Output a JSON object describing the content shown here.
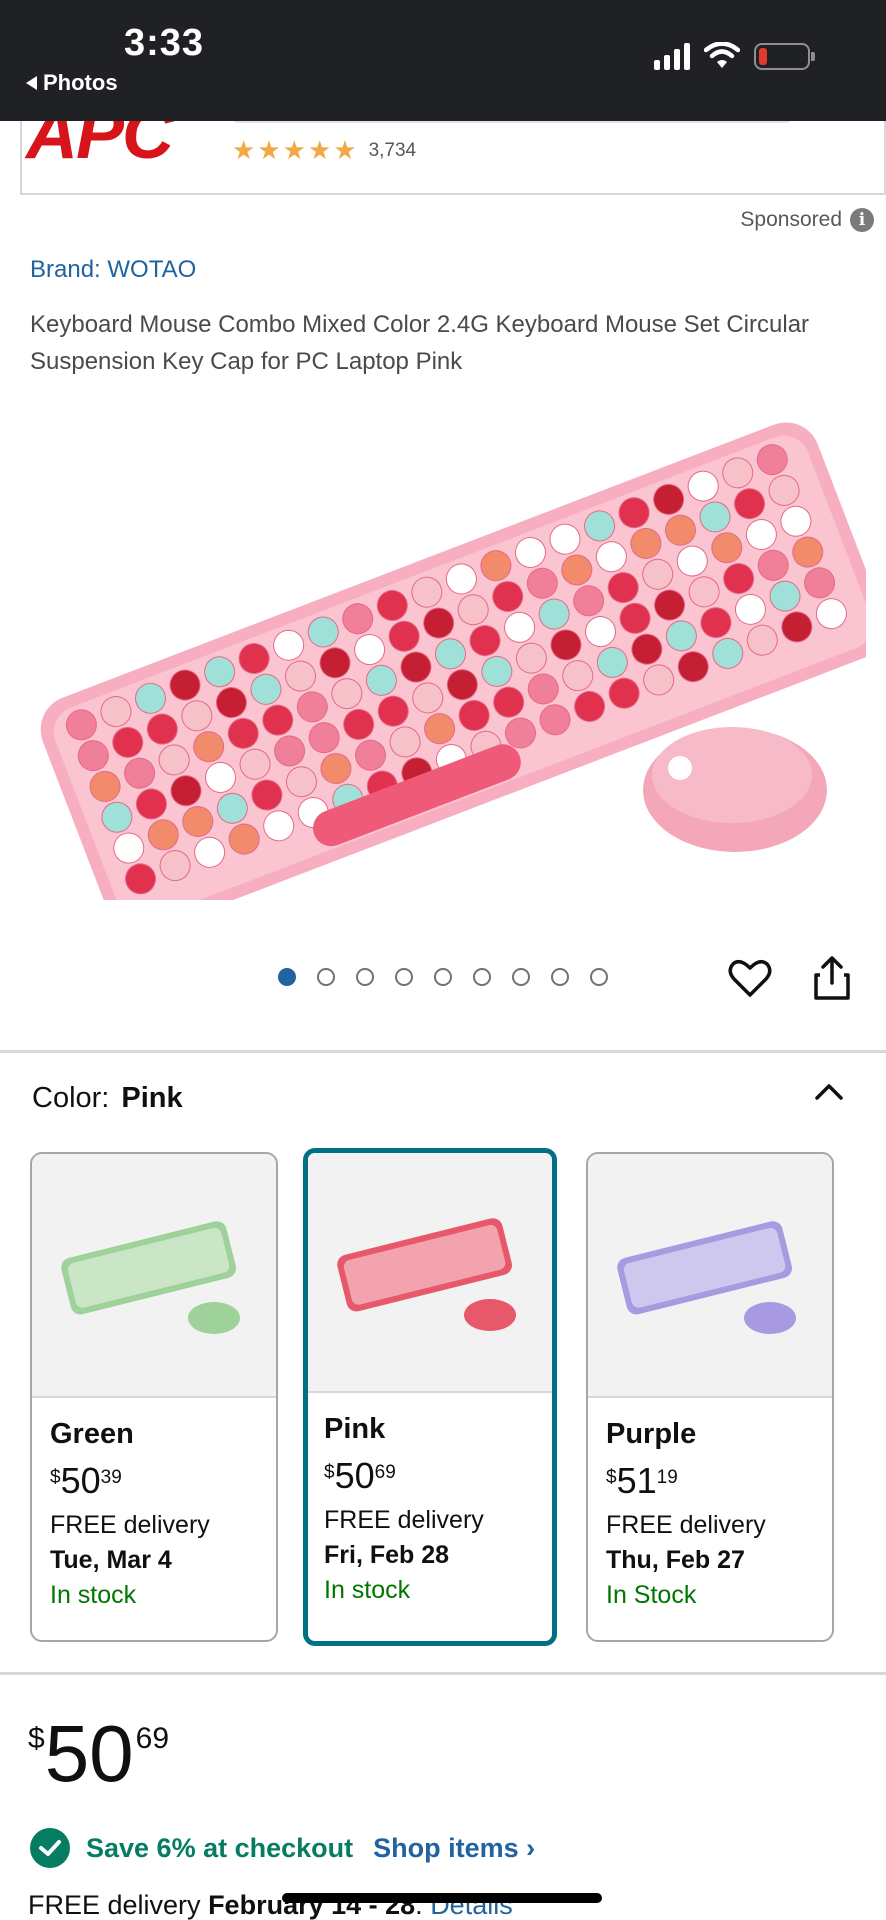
{
  "status_bar": {
    "time": "3:33",
    "back_label": "Photos",
    "icons": [
      "signal-icon",
      "wifi-icon",
      "battery-low-icon"
    ]
  },
  "ad_banner": {
    "logo_text": "APC",
    "rating_count": "3,734",
    "stars": 4.5
  },
  "sponsored_label": "Sponsored",
  "product": {
    "brand": "Brand: WOTAO",
    "title": "Keyboard Mouse Combo Mixed Color 2.4G Keyboard Mouse Set Circular Suspension Key Cap for PC Laptop Pink",
    "image_count": 9,
    "active_image": 1
  },
  "color_selector": {
    "label": "Color:",
    "selected": "Pink",
    "options": [
      {
        "name": "Green",
        "currency": "$",
        "whole": "50",
        "fraction": "39",
        "delivery": "FREE delivery",
        "date": "Tue, Mar 4",
        "stock": "In stock",
        "accent": "#9fd19a"
      },
      {
        "name": "Pink",
        "currency": "$",
        "whole": "50",
        "fraction": "69",
        "delivery": "FREE delivery",
        "date": "Fri, Feb 28",
        "stock": "In stock",
        "accent": "#e8586b"
      },
      {
        "name": "Purple",
        "currency": "$",
        "whole": "51",
        "fraction": "19",
        "delivery": "FREE delivery",
        "date": "Thu, Feb 27",
        "stock": "In Stock",
        "accent": "#a79ae0"
      }
    ]
  },
  "price": {
    "currency": "$",
    "whole": "50",
    "fraction": "69"
  },
  "savings": {
    "text": "Save 6% at checkout",
    "link": "Shop items ›"
  },
  "delivery": {
    "prefix": "FREE delivery ",
    "dates": "February 14 - 28",
    "sep": ". ",
    "link": "Details"
  },
  "colors": {
    "link": "#2162a1",
    "teal": "#007185",
    "stock_green": "#007600",
    "save_green": "#067d62"
  }
}
